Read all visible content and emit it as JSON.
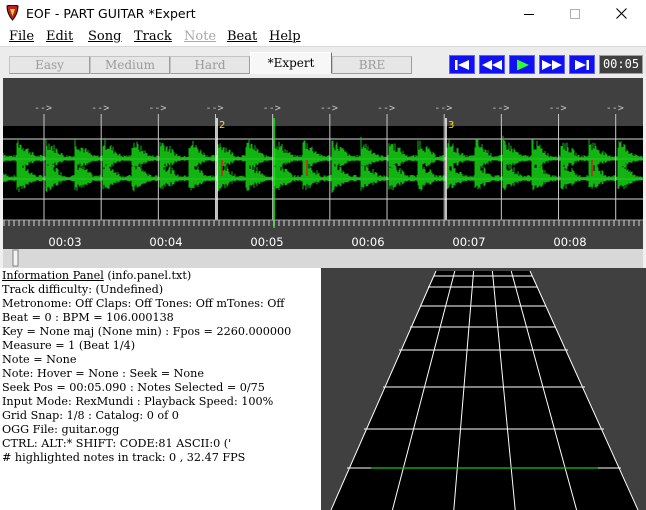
{
  "window": {
    "title": "EOF - PART GUITAR  *Expert"
  },
  "menu": [
    {
      "label": "File",
      "enabled": true
    },
    {
      "label": "Edit",
      "enabled": true
    },
    {
      "label": "Song",
      "enabled": true
    },
    {
      "label": "Track",
      "enabled": true
    },
    {
      "label": "Note",
      "enabled": false
    },
    {
      "label": "Beat",
      "enabled": true
    },
    {
      "label": "Help",
      "enabled": true
    }
  ],
  "difficulty_tabs": [
    {
      "label": "Easy",
      "active": false
    },
    {
      "label": "Medium",
      "active": false
    },
    {
      "label": "Hard",
      "active": false
    },
    {
      "label": "*Expert",
      "active": true
    },
    {
      "label": "BRE",
      "active": false
    }
  ],
  "transport": {
    "buttons": [
      "skip-to-start",
      "rewind",
      "play",
      "fast-forward",
      "skip-to-end"
    ],
    "time": "00:05"
  },
  "editor": {
    "timeline_labels": [
      "00:03",
      "00:04",
      "00:05",
      "00:06",
      "00:07",
      "00:08"
    ],
    "measure_markers": [
      "2",
      "3"
    ],
    "beat_arrow": "-->",
    "colors": {
      "background": "#404040",
      "string_band": "#000000",
      "waveform": "#14c814",
      "cursor": "#00ff00",
      "marker": "#ffe000"
    }
  },
  "info_panel": {
    "title": "Information Panel",
    "title_suffix": " (info.panel.txt)",
    "lines": [
      "Track difficulty: (Undefined)",
      "Metronome: Off Claps: Off  Tones: Off  mTones: Off",
      "Beat = 0 : BPM = 106.000138",
      "Key = None maj (None min) : Fpos = 2260.000000",
      "Measure = 1 (Beat 1/4)",
      "Note = None",
      "Note: Hover = None : Seek = None",
      "Seek Pos = 00:05.090 : Notes Selected = 0/75",
      "Input Mode: RexMundi : Playback Speed: 100%",
      "Grid Snap: 1/8 : Catalog: 0  of  0",
      "OGG File: guitar.ogg",
      "CTRL:   ALT:* SHIFT:   CODE:81 ASCII:0 ('",
      "# highlighted notes in track: 0 , 32.47 FPS"
    ]
  }
}
